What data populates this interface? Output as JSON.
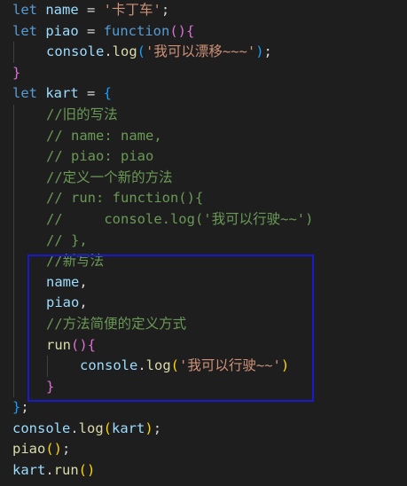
{
  "colors": {
    "background": "#1e1e1e",
    "keyword": "#569cd6",
    "variable": "#9cdcfe",
    "function": "#dcdcaa",
    "string": "#ce9178",
    "comment": "#6a9955",
    "bracket_level1": "#ffd700",
    "bracket_level2": "#da70d6",
    "bracket_level3": "#179fff",
    "annotation_box": "#1a1acd"
  },
  "lines": [
    {
      "indent": 0,
      "tokens": [
        {
          "t": "let",
          "c": "kw"
        },
        {
          "t": " ",
          "c": "op"
        },
        {
          "t": "name",
          "c": "var"
        },
        {
          "t": " = ",
          "c": "op"
        },
        {
          "t": "'卡丁车'",
          "c": "str"
        },
        {
          "t": ";",
          "c": "op"
        }
      ]
    },
    {
      "indent": 0,
      "tokens": [
        {
          "t": "let",
          "c": "kw"
        },
        {
          "t": " ",
          "c": "op"
        },
        {
          "t": "piao",
          "c": "var"
        },
        {
          "t": " = ",
          "c": "op"
        },
        {
          "t": "function",
          "c": "kw"
        },
        {
          "t": "()",
          "c": "b2"
        },
        {
          "t": "{",
          "c": "b2"
        }
      ]
    },
    {
      "indent": 1,
      "tokens": [
        {
          "t": "console",
          "c": "var"
        },
        {
          "t": ".",
          "c": "op"
        },
        {
          "t": "log",
          "c": "fn"
        },
        {
          "t": "(",
          "c": "b3"
        },
        {
          "t": "'我可以漂移~~~'",
          "c": "str"
        },
        {
          "t": ")",
          "c": "b3"
        },
        {
          "t": ";",
          "c": "op"
        }
      ]
    },
    {
      "indent": 0,
      "tokens": [
        {
          "t": "}",
          "c": "b2"
        }
      ]
    },
    {
      "indent": 0,
      "tokens": [
        {
          "t": "let",
          "c": "kw"
        },
        {
          "t": " ",
          "c": "op"
        },
        {
          "t": "kart",
          "c": "var"
        },
        {
          "t": " = ",
          "c": "op"
        },
        {
          "t": "{",
          "c": "b3"
        }
      ]
    },
    {
      "indent": 1,
      "tokens": [
        {
          "t": "//旧的写法",
          "c": "cm"
        }
      ]
    },
    {
      "indent": 1,
      "tokens": [
        {
          "t": "// name: name,",
          "c": "cm"
        }
      ]
    },
    {
      "indent": 1,
      "tokens": [
        {
          "t": "// piao: piao",
          "c": "cm"
        }
      ]
    },
    {
      "indent": 1,
      "tokens": [
        {
          "t": "//定义一个新的方法",
          "c": "cm"
        }
      ]
    },
    {
      "indent": 1,
      "tokens": [
        {
          "t": "// run: function(){",
          "c": "cm"
        }
      ]
    },
    {
      "indent": 1,
      "tokens": [
        {
          "t": "//     console.log('我可以行驶~~')",
          "c": "cm"
        }
      ]
    },
    {
      "indent": 1,
      "tokens": [
        {
          "t": "// },",
          "c": "cm"
        }
      ]
    },
    {
      "indent": 1,
      "tokens": [
        {
          "t": "//新写法",
          "c": "cm"
        }
      ]
    },
    {
      "indent": 1,
      "tokens": [
        {
          "t": "name",
          "c": "var"
        },
        {
          "t": ",",
          "c": "op"
        }
      ]
    },
    {
      "indent": 1,
      "tokens": [
        {
          "t": "piao",
          "c": "var"
        },
        {
          "t": ",",
          "c": "op"
        }
      ]
    },
    {
      "indent": 1,
      "tokens": [
        {
          "t": "//方法简便的定义方式",
          "c": "cm"
        }
      ]
    },
    {
      "indent": 1,
      "tokens": [
        {
          "t": "run",
          "c": "fn"
        },
        {
          "t": "()",
          "c": "b2"
        },
        {
          "t": "{",
          "c": "b2"
        }
      ]
    },
    {
      "indent": 2,
      "tokens": [
        {
          "t": "console",
          "c": "var"
        },
        {
          "t": ".",
          "c": "op"
        },
        {
          "t": "log",
          "c": "fn"
        },
        {
          "t": "(",
          "c": "b1"
        },
        {
          "t": "'我可以行驶~~'",
          "c": "str"
        },
        {
          "t": ")",
          "c": "b1"
        }
      ]
    },
    {
      "indent": 1,
      "tokens": [
        {
          "t": "}",
          "c": "b2"
        }
      ]
    },
    {
      "indent": 0,
      "tokens": [
        {
          "t": "}",
          "c": "b3"
        },
        {
          "t": ";",
          "c": "op"
        }
      ]
    },
    {
      "indent": 0,
      "tokens": [
        {
          "t": "console",
          "c": "var"
        },
        {
          "t": ".",
          "c": "op"
        },
        {
          "t": "log",
          "c": "fn"
        },
        {
          "t": "(",
          "c": "b1"
        },
        {
          "t": "kart",
          "c": "var"
        },
        {
          "t": ")",
          "c": "b1"
        },
        {
          "t": ";",
          "c": "op"
        }
      ]
    },
    {
      "indent": 0,
      "tokens": [
        {
          "t": "piao",
          "c": "fn"
        },
        {
          "t": "()",
          "c": "b1"
        },
        {
          "t": ";",
          "c": "op"
        }
      ]
    },
    {
      "indent": 0,
      "tokens": [
        {
          "t": "kart",
          "c": "var"
        },
        {
          "t": ".",
          "c": "op"
        },
        {
          "t": "run",
          "c": "fn"
        },
        {
          "t": "()",
          "c": "b1"
        }
      ]
    }
  ]
}
